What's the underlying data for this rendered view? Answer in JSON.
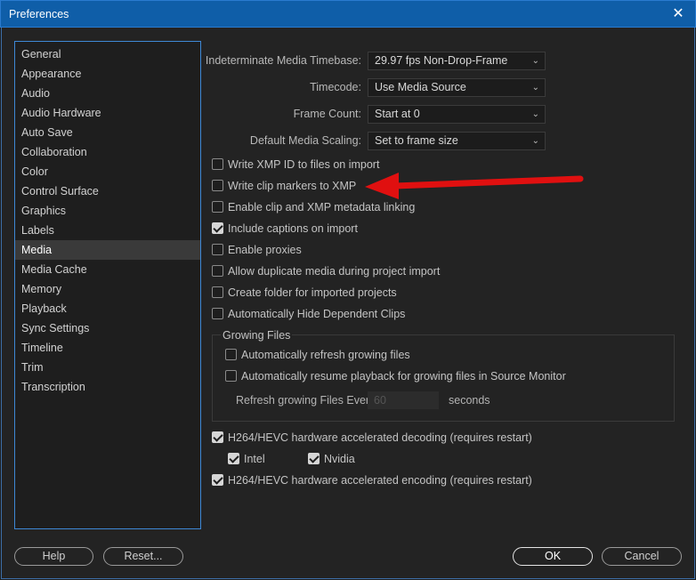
{
  "window": {
    "title": "Preferences",
    "close_glyph": "✕"
  },
  "sidebar": {
    "items": [
      {
        "label": "General"
      },
      {
        "label": "Appearance"
      },
      {
        "label": "Audio"
      },
      {
        "label": "Audio Hardware"
      },
      {
        "label": "Auto Save"
      },
      {
        "label": "Collaboration"
      },
      {
        "label": "Color"
      },
      {
        "label": "Control Surface"
      },
      {
        "label": "Graphics"
      },
      {
        "label": "Labels"
      },
      {
        "label": "Media"
      },
      {
        "label": "Media Cache"
      },
      {
        "label": "Memory"
      },
      {
        "label": "Playback"
      },
      {
        "label": "Sync Settings"
      },
      {
        "label": "Timeline"
      },
      {
        "label": "Trim"
      },
      {
        "label": "Transcription"
      }
    ],
    "selected": "Media"
  },
  "fields": {
    "timebase": {
      "label": "Indeterminate Media Timebase:",
      "value": "29.97 fps Non-Drop-Frame"
    },
    "timecode": {
      "label": "Timecode:",
      "value": "Use Media Source"
    },
    "frame_count": {
      "label": "Frame Count:",
      "value": "Start at 0"
    },
    "scaling": {
      "label": "Default Media Scaling:",
      "value": "Set to frame size"
    }
  },
  "checkboxes": {
    "write_xmp_id": {
      "label": "Write XMP ID to files on import",
      "checked": false
    },
    "write_clip_markers": {
      "label": "Write clip markers to XMP",
      "checked": false
    },
    "enable_linking": {
      "label": "Enable clip and XMP metadata linking",
      "checked": false
    },
    "include_captions": {
      "label": "Include captions on import",
      "checked": true
    },
    "enable_proxies": {
      "label": "Enable proxies",
      "checked": false
    },
    "allow_duplicate": {
      "label": "Allow duplicate media during project import",
      "checked": false
    },
    "create_folder": {
      "label": "Create folder for imported projects",
      "checked": false
    },
    "auto_hide": {
      "label": "Automatically Hide Dependent Clips",
      "checked": false
    }
  },
  "growing_files": {
    "title": "Growing Files",
    "auto_refresh": {
      "label": "Automatically refresh growing files",
      "checked": false
    },
    "auto_resume": {
      "label": "Automatically resume playback for growing files in Source Monitor",
      "checked": false
    },
    "refresh_label": "Refresh growing Files Every",
    "refresh_value": "60",
    "refresh_unit": "seconds"
  },
  "hardware": {
    "decoding": {
      "label": "H264/HEVC hardware accelerated decoding (requires restart)",
      "checked": true
    },
    "intel": {
      "label": "Intel",
      "checked": true
    },
    "nvidia": {
      "label": "Nvidia",
      "checked": true
    },
    "encoding": {
      "label": "H264/HEVC hardware accelerated encoding (requires restart)",
      "checked": true
    }
  },
  "buttons": {
    "help": "Help",
    "reset": "Reset...",
    "ok": "OK",
    "cancel": "Cancel"
  },
  "annotation": {
    "color": "#e01010"
  }
}
